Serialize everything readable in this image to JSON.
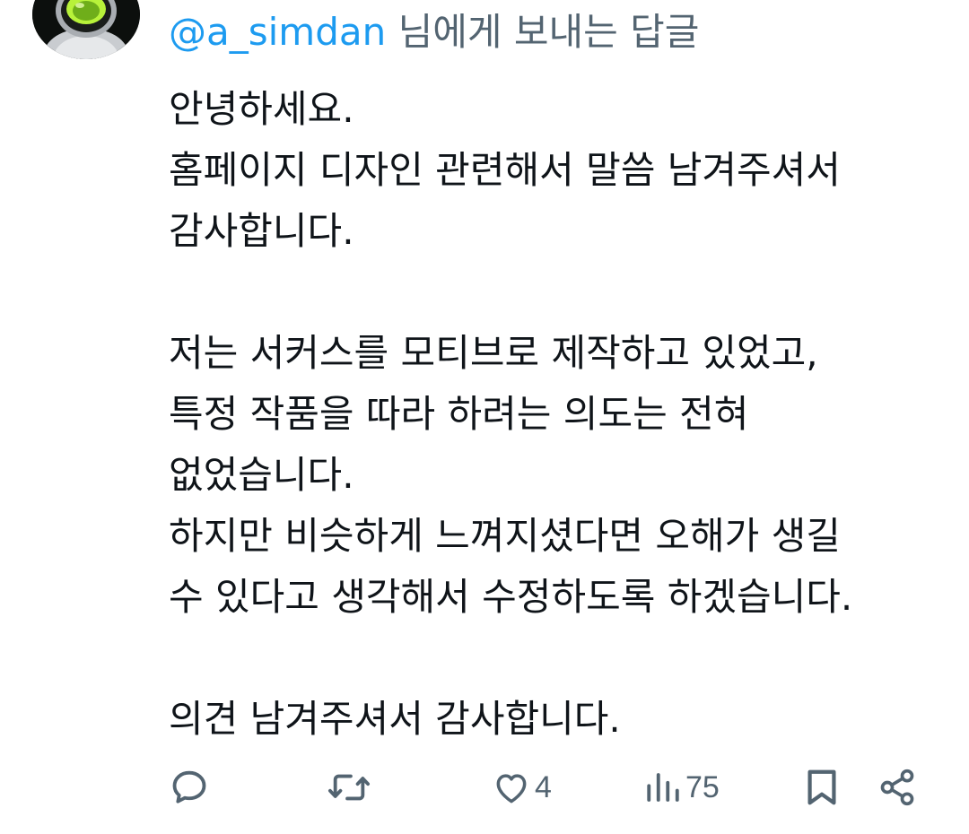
{
  "reply_header": {
    "handle": "@a_simdan",
    "suffix": " 님에게 보내는 답글"
  },
  "tweet": {
    "lines": [
      "안녕하세요.",
      "홈페이지 디자인 관련해서 말씀 남겨주셔서",
      "감사합니다.",
      "",
      "저는 서커스를 모티브로 제작하고 있었고,",
      "특정 작품을 따라 하려는 의도는 전혀",
      "없었습니다.",
      "하지만 비슷하게 느껴지셨다면 오해가 생길",
      "수 있다고 생각해서 수정하도록 하겠습니다.",
      "",
      "의견 남겨주셔서 감사합니다."
    ]
  },
  "actions": {
    "reply_icon": "reply-icon",
    "retweet_icon": "retweet-icon",
    "like_icon": "heart-icon",
    "like_count": "4",
    "views_icon": "views-icon",
    "views_count": "75",
    "bookmark_icon": "bookmark-icon",
    "share_icon": "share-icon"
  },
  "colors": {
    "handle": "#1d9bf0",
    "secondary": "#536471",
    "text": "#0f1419",
    "avatar_accent": "#b8f23a"
  }
}
